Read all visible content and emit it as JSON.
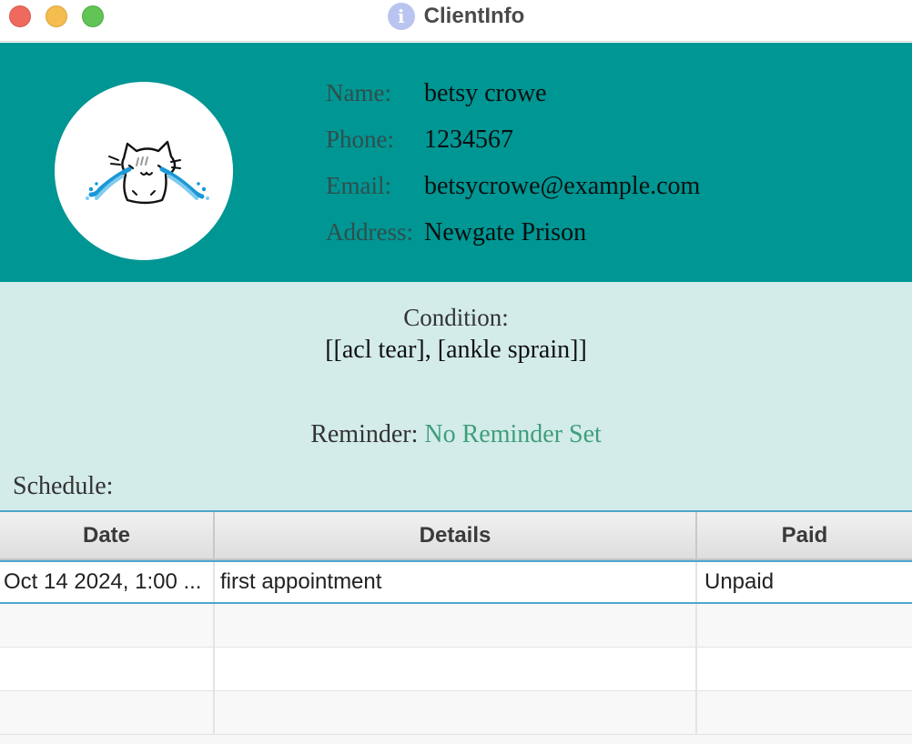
{
  "window": {
    "title": "ClientInfo"
  },
  "client": {
    "name_label": "Name:",
    "name": "betsy crowe",
    "phone_label": "Phone:",
    "phone": "1234567",
    "email_label": "Email:",
    "email": "betsycrowe@example.com",
    "address_label": "Address:",
    "address": "Newgate Prison"
  },
  "details": {
    "condition_label": "Condition:",
    "condition_value": "[[acl tear], [ankle sprain]]",
    "reminder_label": "Reminder:",
    "reminder_value": "No Reminder Set",
    "schedule_label": "Schedule:"
  },
  "schedule_table": {
    "headers": [
      "Date",
      "Details",
      "Paid"
    ],
    "rows": [
      [
        "Oct 14 2024, 1:00 ...",
        "first appointment",
        "Unpaid"
      ]
    ]
  },
  "colors": {
    "header_bg": "#009693",
    "panel_bg": "#d3ece9",
    "reminder_accent": "#3f9e7c",
    "selection": "#4ea6cc"
  },
  "icons": {
    "title": "info-icon",
    "avatar": "crying-cat-avatar"
  }
}
